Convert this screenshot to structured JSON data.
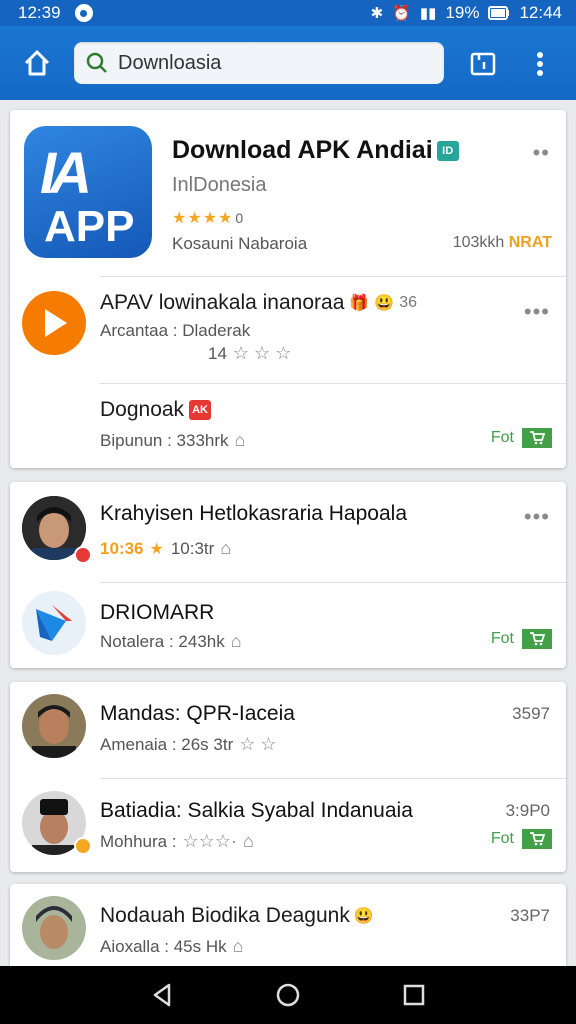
{
  "status_bar": {
    "time_left": "12:39",
    "battery_percent": "19%",
    "time_right": "12:44",
    "background": "#1565c0"
  },
  "app_bar": {
    "search_value": "Downloasia",
    "icons": [
      "home-icon",
      "search-icon",
      "tabs-icon",
      "more-vertical-icon"
    ]
  },
  "featured": {
    "logo_line1": "IA",
    "logo_line2": "APP",
    "title": "Download APK Andiai",
    "title_badge": "ID",
    "subtitle": "InlDonesia",
    "rating": "★★★★",
    "rating_suffix": "0",
    "developer": "Kosauni Nabaroia",
    "downloads": "103kkh",
    "downloads_tag": "NRAT"
  },
  "card1_rows": [
    {
      "title": "APAV lowinakala inanoraa",
      "sub": "Arcantaa : Dladerak",
      "rating_num": "14",
      "right_value": "36"
    },
    {
      "title": "Dognoak",
      "sub": "Bipunun : 333hrk",
      "badge": "AK",
      "action": "Fot"
    }
  ],
  "card2_rows": [
    {
      "title": "Krahyisen Hetlokasraria Hapoala",
      "sub_accent": "10:36",
      "sub": "10:3tr"
    },
    {
      "title": "DRIOMARR",
      "sub": "Notalera : 243hk",
      "action": "Fot"
    }
  ],
  "card3_rows": [
    {
      "title": "Mandas: QPR-Iaceia",
      "sub": "Amenaia : 26s 3tr",
      "right_value": "3597"
    },
    {
      "title": "Batiadia: Salkia Syabal Indanuaia",
      "sub": "Mohhura :",
      "right_value": "3:9P0",
      "action": "Fot"
    }
  ],
  "card4_rows": [
    {
      "title": "Nodauah Biodika Deagunk",
      "sub": "Aioxalla : 45s Hk",
      "right_value": "33P7"
    }
  ],
  "nav_bar": {
    "icons": [
      "back-icon",
      "home-circle-icon",
      "recents-icon"
    ]
  },
  "colors": {
    "primary": "#1976d2",
    "accent_star": "#f5a623",
    "free_green": "#43a047",
    "play_orange": "#f57c00"
  }
}
